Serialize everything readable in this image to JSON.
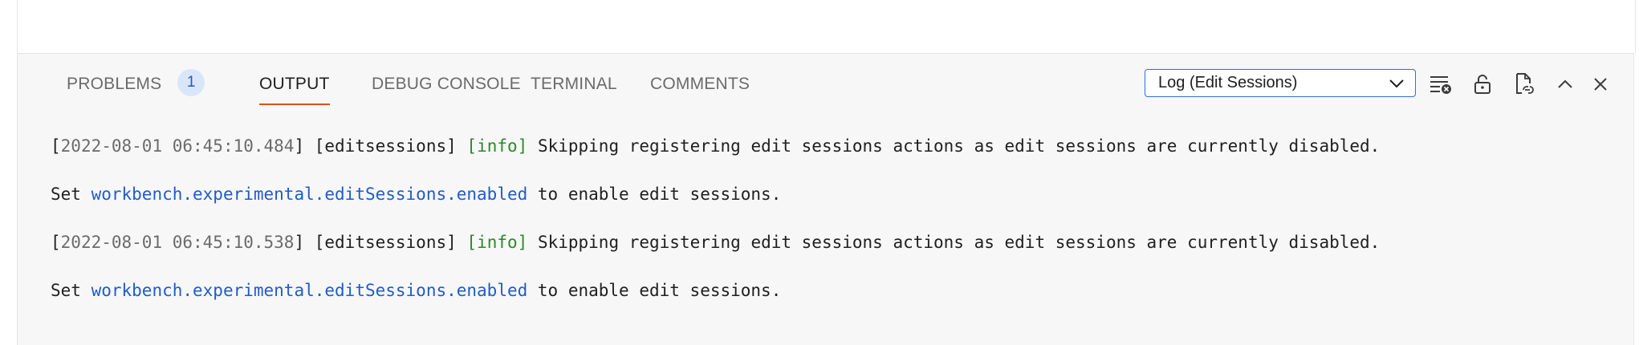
{
  "tabs": [
    {
      "label": "PROBLEMS",
      "badge": "1"
    },
    {
      "label": "OUTPUT"
    },
    {
      "label": "DEBUG CONSOLE"
    },
    {
      "label": "TERMINAL"
    },
    {
      "label": "COMMENTS"
    }
  ],
  "active_tab": "OUTPUT",
  "channel_select": {
    "value": "Log (Edit Sessions)"
  },
  "actions": [
    "clear-output-icon",
    "lock-scroll-icon",
    "open-log-file-icon",
    "maximize-panel-icon",
    "close-panel-icon"
  ],
  "log": [
    {
      "timestamp": "2022-08-01 06:45:10.484",
      "source": "[editsessions]",
      "level": "[info]",
      "message": "Skipping registering edit sessions actions as edit sessions are currently disabled.",
      "cont_prefix": "Set",
      "setting": "workbench.experimental.editSessions.enabled",
      "cont_suffix": "to enable edit sessions."
    },
    {
      "timestamp": "2022-08-01 06:45:10.538",
      "source": "[editsessions]",
      "level": "[info]",
      "message": "Skipping registering edit sessions actions as edit sessions are currently disabled.",
      "cont_prefix": "Set",
      "setting": "workbench.experimental.editSessions.enabled",
      "cont_suffix": "to enable edit sessions."
    }
  ]
}
